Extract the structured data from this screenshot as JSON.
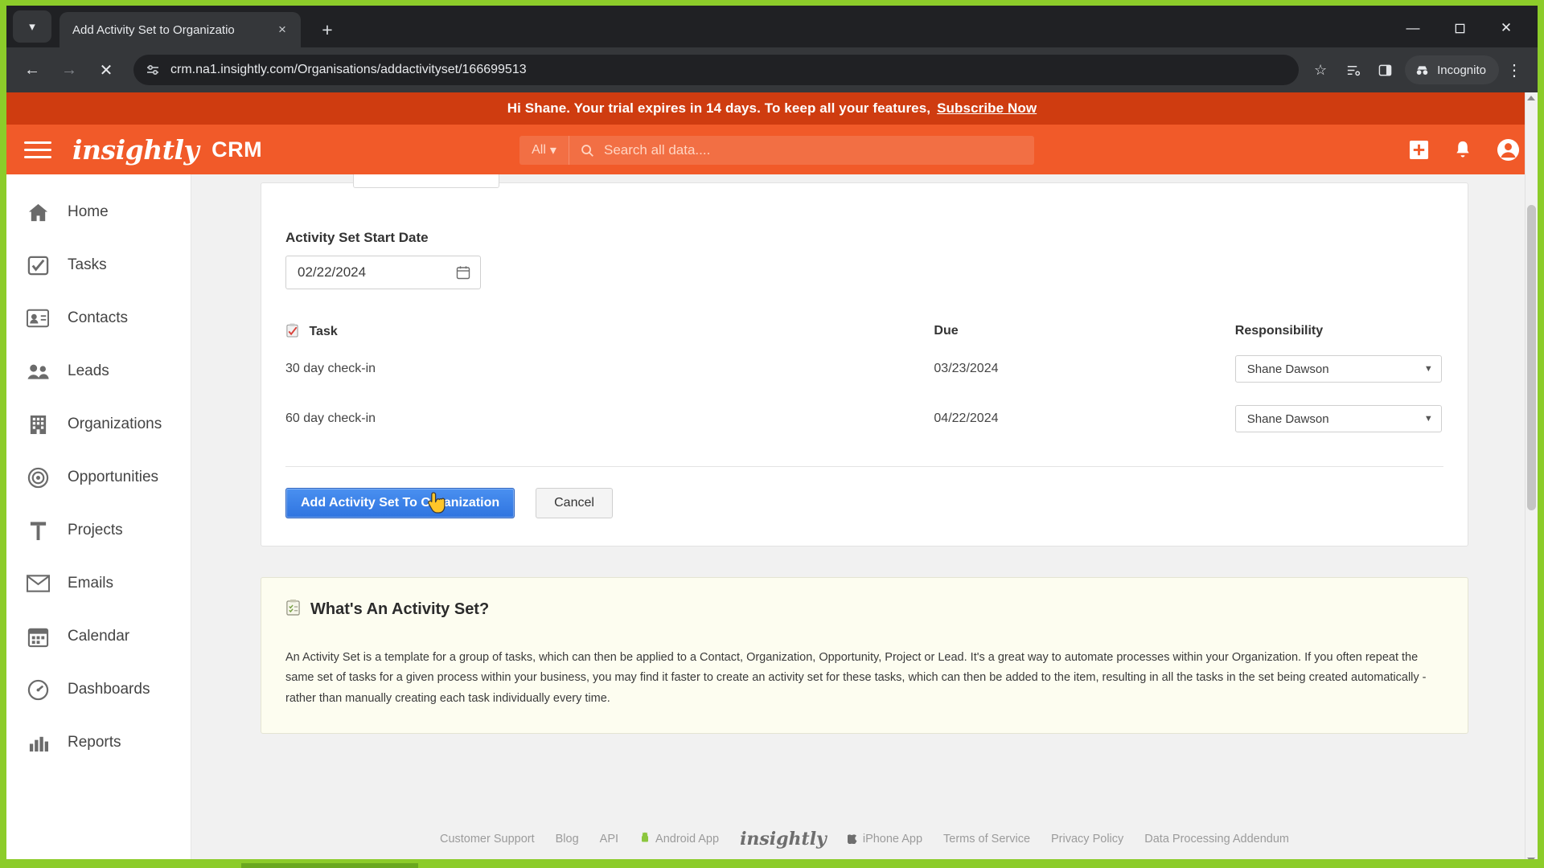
{
  "browser": {
    "tab_title": "Add Activity Set to Organizatio",
    "new_tab_label": "+",
    "close_tab_label": "×",
    "url": "crm.na1.insightly.com/Organisations/addactivityset/166699513",
    "incognito_label": "Incognito",
    "minimize_label": "—",
    "maximize_label": "❐",
    "close_label": "✕",
    "back_label": "←",
    "forward_label": "→",
    "stop_label": "✕"
  },
  "banner": {
    "message": "Hi Shane. Your trial expires in 14 days. To keep all your features,",
    "cta": "Subscribe Now"
  },
  "appbar": {
    "brand": "insightly",
    "product": "CRM",
    "search_scope": "All",
    "search_placeholder": "Search all data....",
    "add_label": "+",
    "accent_color": "#f15a29",
    "banner_color": "#cf3c10"
  },
  "sidebar": {
    "items": [
      {
        "label": "Home",
        "icon": "home-icon"
      },
      {
        "label": "Tasks",
        "icon": "tasks-icon"
      },
      {
        "label": "Contacts",
        "icon": "contacts-icon"
      },
      {
        "label": "Leads",
        "icon": "leads-icon"
      },
      {
        "label": "Organizations",
        "icon": "organizations-icon"
      },
      {
        "label": "Opportunities",
        "icon": "opportunities-icon"
      },
      {
        "label": "Projects",
        "icon": "projects-icon"
      },
      {
        "label": "Emails",
        "icon": "emails-icon"
      },
      {
        "label": "Calendar",
        "icon": "calendar-icon"
      },
      {
        "label": "Dashboards",
        "icon": "dashboards-icon"
      },
      {
        "label": "Reports",
        "icon": "reports-icon"
      }
    ]
  },
  "form": {
    "start_date_label": "Activity Set Start Date",
    "start_date_value": "02/22/2024",
    "columns": {
      "task": "Task",
      "due": "Due",
      "responsibility": "Responsibility"
    },
    "rows": [
      {
        "task": "30 day check-in",
        "due": "03/23/2024",
        "responsibility": "Shane Dawson"
      },
      {
        "task": "60 day check-in",
        "due": "04/22/2024",
        "responsibility": "Shane Dawson"
      }
    ],
    "submit_label": "Add Activity Set To Organization",
    "cancel_label": "Cancel",
    "submit_color": "#2f74e0"
  },
  "info": {
    "title": "What's An Activity Set?",
    "body": "An Activity Set is a template for a group of tasks, which can then be applied to a Contact, Organization, Opportunity, Project or Lead. It's a great way to automate processes within your Organization. If you often repeat the same set of tasks for a given process within your business, you may find it faster to create an activity set for these tasks, which can then be added to the item, resulting in all the tasks in the set being created automatically - rather than manually creating each task individually every time."
  },
  "footer": {
    "links": [
      "Customer Support",
      "Blog",
      "API",
      "Android App",
      "iPhone App",
      "Terms of Service",
      "Privacy Policy",
      "Data Processing Addendum"
    ],
    "brand": "insightly"
  }
}
